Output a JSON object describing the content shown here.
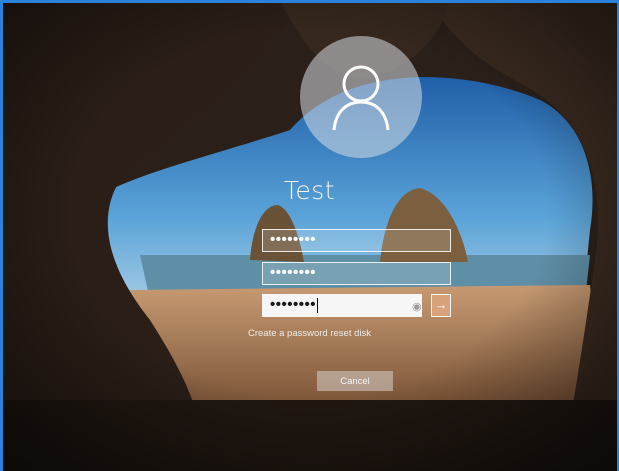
{
  "user": {
    "name": "Test",
    "avatar_icon": "user-icon"
  },
  "fields": {
    "password_value": "••••••••",
    "confirm_value": "••••••••",
    "hint_value": "••••••••",
    "reveal_icon": "eye-icon",
    "submit_icon": "arrow-right-icon",
    "submit_glyph": "→"
  },
  "links": {
    "reset_disk": "Create a password reset disk"
  },
  "buttons": {
    "cancel": "Cancel"
  },
  "colors": {
    "window_border": "#2a82da",
    "submit_bg": "#d8a27a"
  }
}
